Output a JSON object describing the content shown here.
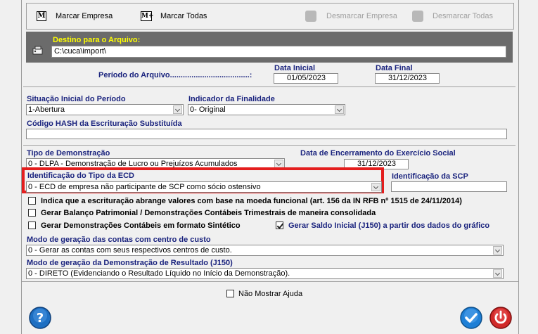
{
  "toolbar": {
    "marcar_empresa": "Marcar Empresa",
    "marcar_todas": "Marcar Todas",
    "desmarcar_empresa": "Desmarcar Empresa",
    "desmarcar_todas": "Desmarcar Todas",
    "m_icon": "M",
    "m_plus_icon": "M+"
  },
  "destino": {
    "label": "Destino para o Arquivo:",
    "value": "C:\\cuca\\import\\"
  },
  "periodo": {
    "label": "Período do Arquivo.....................................:",
    "data_inicial_label": "Data Inicial",
    "data_inicial": "01/05/2023",
    "data_final_label": "Data Final",
    "data_final": "31/12/2023"
  },
  "situacao": {
    "label": "Situação Inicial do Período",
    "value": "1-Abertura"
  },
  "finalidade": {
    "label": "Indicador da Finalidade",
    "value": "0- Original"
  },
  "hash": {
    "label": "Código HASH da Escrituração Substituída",
    "value": ""
  },
  "tipo_demonstracao": {
    "label": "Tipo de Demonstração",
    "value": "0 - DLPA - Demonstração de Lucro ou Prejuízos Acumulados"
  },
  "encerramento": {
    "label": "Data de Encerramento do Exercício Social",
    "value": "31/12/2023"
  },
  "ident_ecd": {
    "label": "Identificação do Tipo da ECD",
    "value": "0 - ECD de empresa não participante de SCP como sócio ostensivo"
  },
  "ident_scp": {
    "label": "Identificação da SCP",
    "value": ""
  },
  "checks": [
    {
      "label": "Indica que a escrituração abrange valores com base na moeda funcional (art. 156 da IN RFB nº 1515 de 24/11/2014)",
      "checked": false
    },
    {
      "label": "Gerar Balanço Patrimonial / Demonstrações Contábeis Trimestrais de maneira consolidada",
      "checked": false
    },
    {
      "label": "Gerar Demonstrações Contábeis em formato Sintético",
      "checked": false
    },
    {
      "label": "Gerar Saldo Inicial (J150) a partir dos dados do gráfico",
      "checked": true
    }
  ],
  "modo_contas": {
    "label": "Modo de geração das contas com centro de custo",
    "value": "0 - Gerar as contas com seus respectivos centros de custo."
  },
  "modo_dre": {
    "label": "Modo de geração da Demonstração de Resultado (J150)",
    "value": "0 - DIRETO (Evidenciando o Resultado Líquido no Início da Demonstração)."
  },
  "nao_mostrar": {
    "label": "Não Mostrar Ajuda",
    "checked": false
  },
  "colors": {
    "label_blue": "#1a237e",
    "destino_bg": "#6b6b6b",
    "destino_label": "#ffff00",
    "highlight_red": "#e41e1e",
    "help_blue": "#1e6fc2",
    "ok_blue": "#1e7fd6",
    "power_red": "#d12a2a"
  }
}
